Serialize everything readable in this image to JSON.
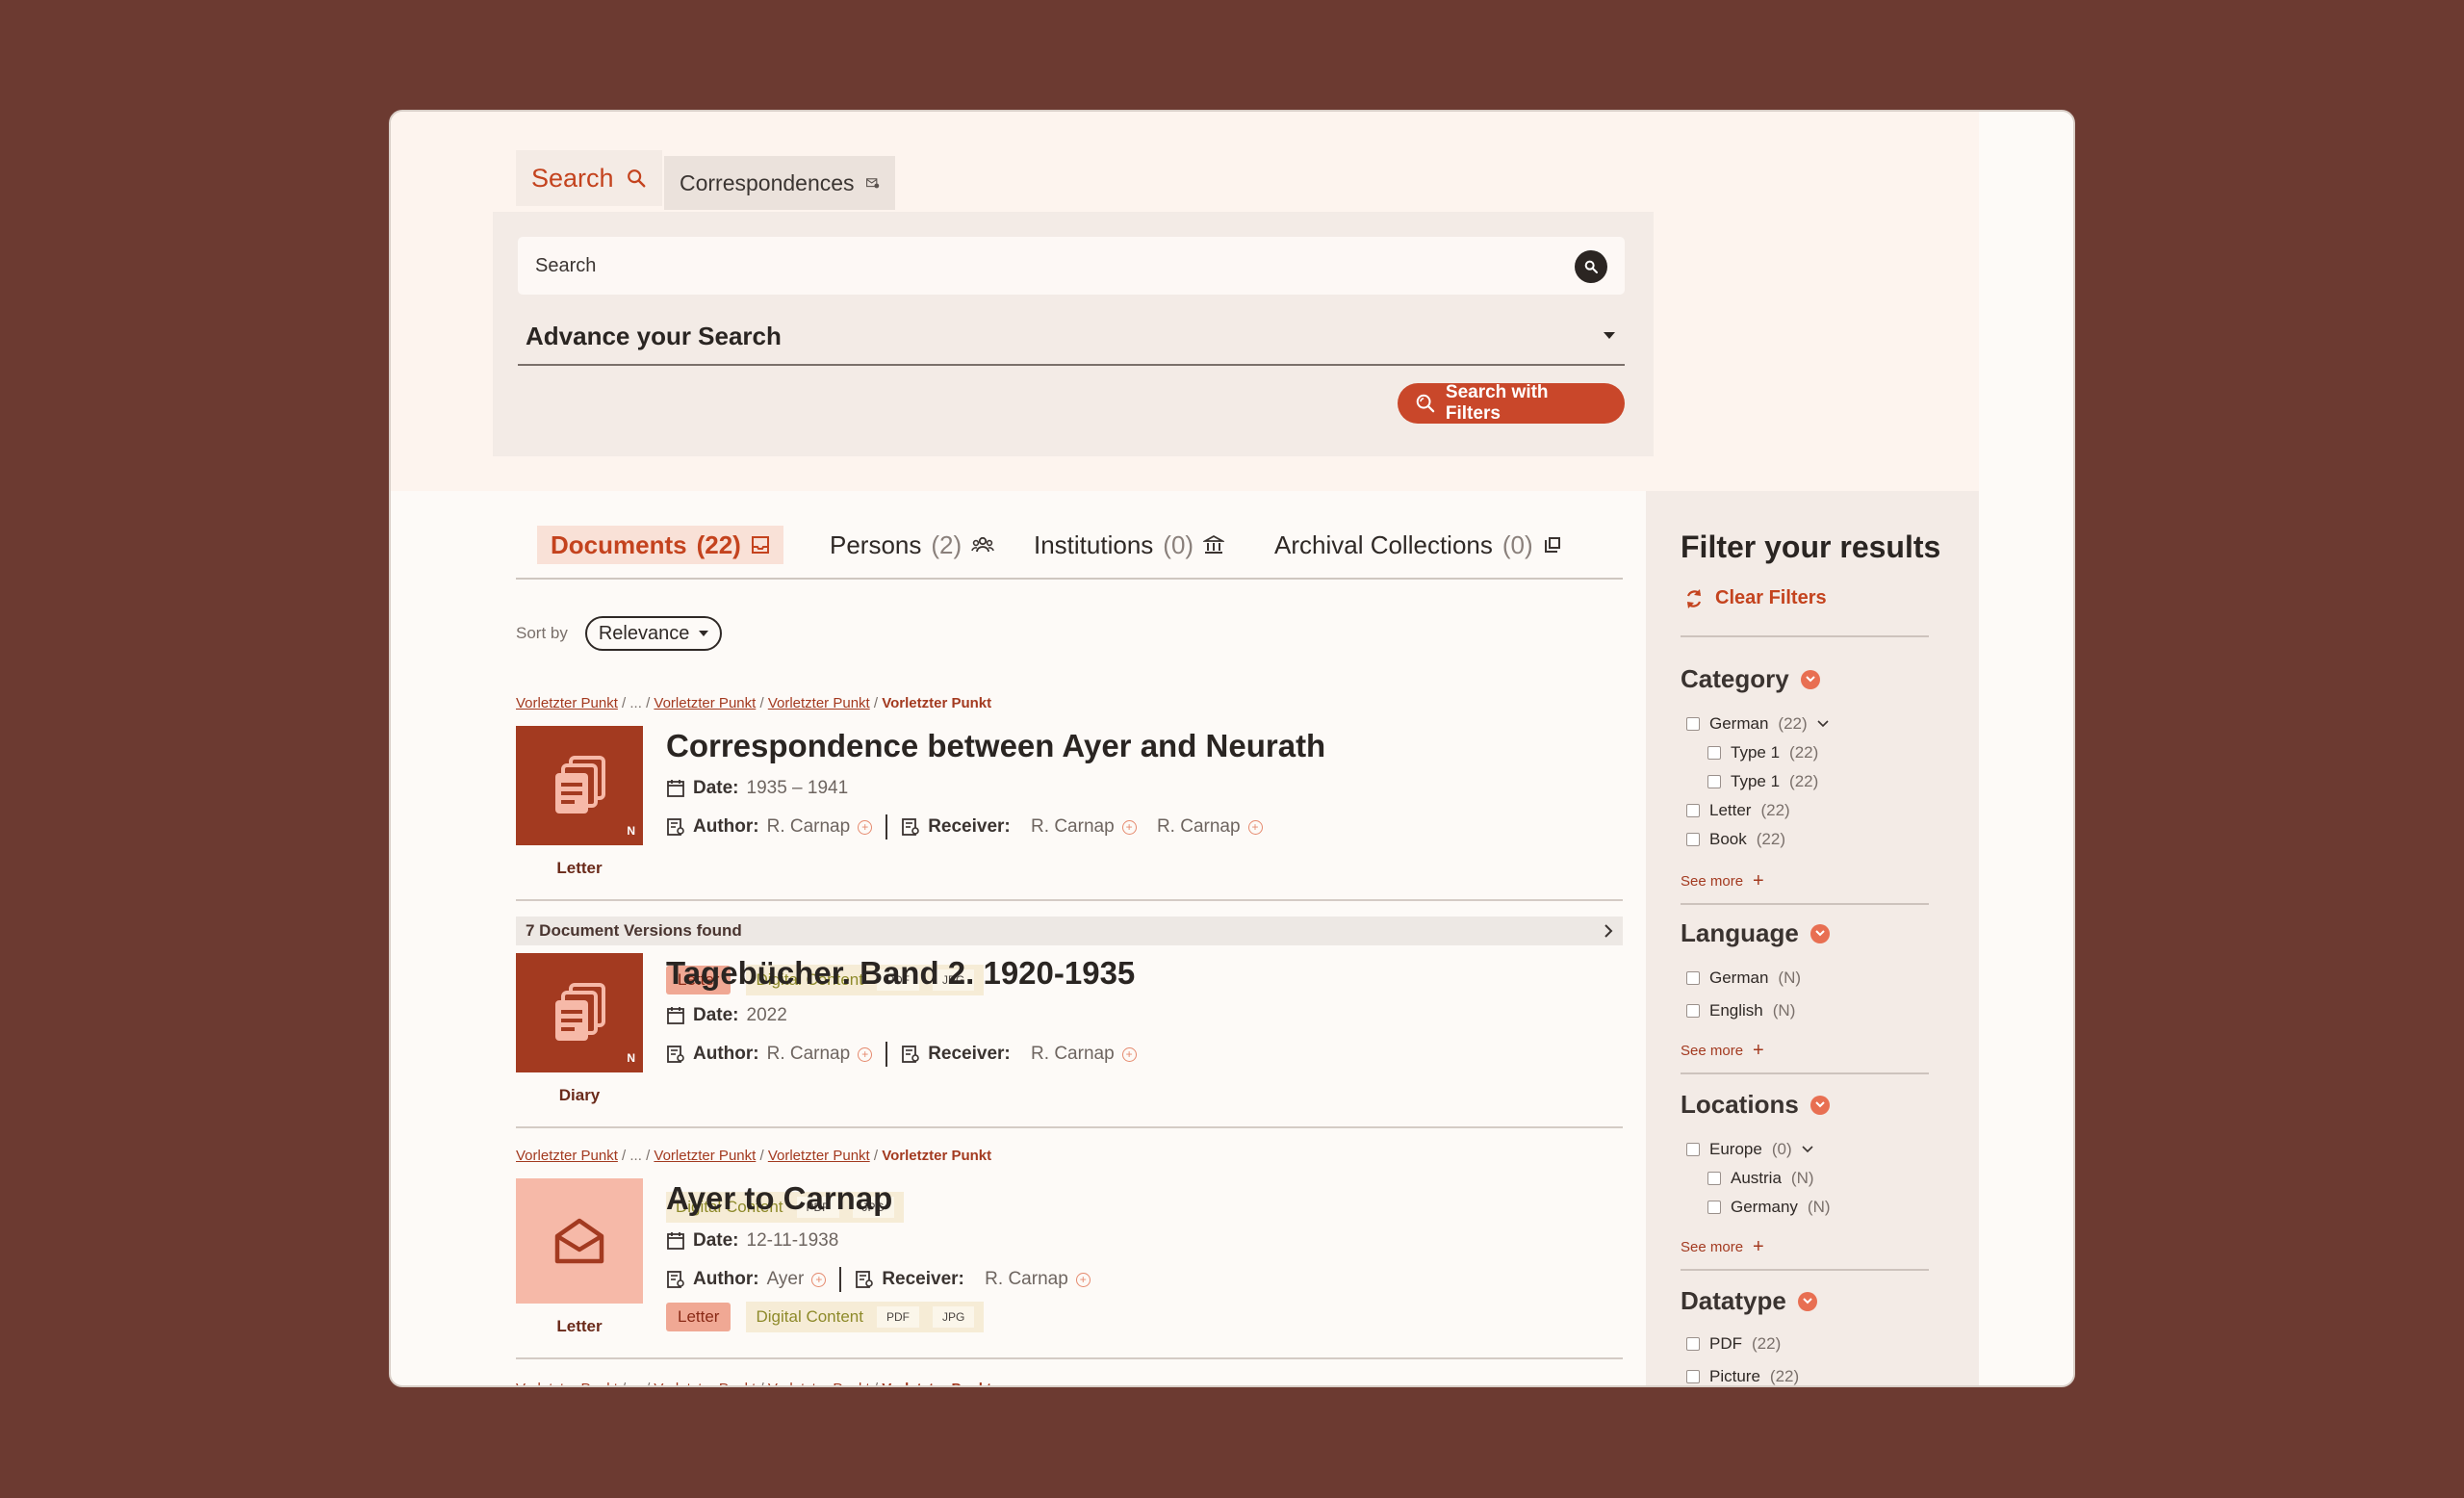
{
  "tabs": {
    "search": "Search",
    "correspondences": "Correspondences"
  },
  "search": {
    "placeholder": "Search",
    "advance_label": "Advance your Search",
    "filter_button": "Search with Filters"
  },
  "result_tabs": [
    {
      "label": "Documents",
      "count": "(22)"
    },
    {
      "label": "Persons",
      "count": "(2)"
    },
    {
      "label": "Institutions",
      "count": "(0)"
    },
    {
      "label": "Archival Collections",
      "count": "(0)"
    }
  ],
  "sort": {
    "label": "Sort by",
    "value": "Relevance"
  },
  "breadcrumb": {
    "first": "Vorletzter Punkt",
    "sep": " / ... / ",
    "second": "Vorletzter Punkt",
    "third": "Vorletzter Punkt",
    "current": "Vorletzter Punkt",
    "slash": " / "
  },
  "docs": [
    {
      "title": "Correspondence between Ayer and Neurath",
      "date_label": "Date:",
      "date": "1935 – 1941",
      "author_label": "Author:",
      "author": "R. Carnap",
      "receiver_label": "Receiver:",
      "receivers": [
        "R. Carnap",
        "R. Carnap"
      ],
      "type": "Letter",
      "type_tag": "Letter",
      "digital": "Digital Content",
      "formats": [
        "PDF",
        "JPG"
      ],
      "badge": "N"
    },
    {
      "title": "Tagebücher. Band 2. 1920-1935",
      "date_label": "Date:",
      "date": "2022",
      "author_label": "Author:",
      "author": "R. Carnap",
      "receiver_label": "Receiver:",
      "receivers": [
        "R. Carnap"
      ],
      "type": "Diary",
      "digital": "Digital Content",
      "formats": [
        "PDF",
        "JPG"
      ],
      "badge": "N"
    },
    {
      "title": "Ayer to Carnap",
      "date_label": "Date:",
      "date": "12-11-1938",
      "author_label": "Author:",
      "author": "Ayer",
      "receiver_label": "Receiver:",
      "receivers": [
        "R. Carnap"
      ],
      "type": "Letter",
      "type_tag": "Letter",
      "digital": "Digital Content",
      "formats": [
        "PDF",
        "JPG"
      ]
    }
  ],
  "versions_found": "7 Document Versions found",
  "filters": {
    "title": "Filter your results",
    "clear": "Clear Filters",
    "see_more": "See more",
    "category": {
      "title": "Category",
      "options": [
        {
          "label": "German",
          "count": "(22)"
        },
        {
          "label": "Type 1",
          "count": "(22)"
        },
        {
          "label": "Type 1",
          "count": "(22)"
        },
        {
          "label": "Letter",
          "count": "(22)"
        },
        {
          "label": "Book",
          "count": "(22)"
        }
      ]
    },
    "language": {
      "title": "Language",
      "options": [
        {
          "label": "German",
          "count": "(N)"
        },
        {
          "label": "English",
          "count": "(N)"
        }
      ]
    },
    "locations": {
      "title": "Locations",
      "options": [
        {
          "label": "Europe",
          "count": "(0)"
        },
        {
          "label": "Austria",
          "count": "(N)"
        },
        {
          "label": "Germany",
          "count": "(N)"
        }
      ]
    },
    "datatype": {
      "title": "Datatype",
      "options": [
        {
          "label": "PDF",
          "count": "(22)"
        },
        {
          "label": "Picture",
          "count": "(22)"
        }
      ]
    }
  },
  "colors": {
    "background": "#6c3a31",
    "accent": "#c9472a",
    "thumb_dark": "#a33a20",
    "thumb_light": "#f6b9a8"
  }
}
